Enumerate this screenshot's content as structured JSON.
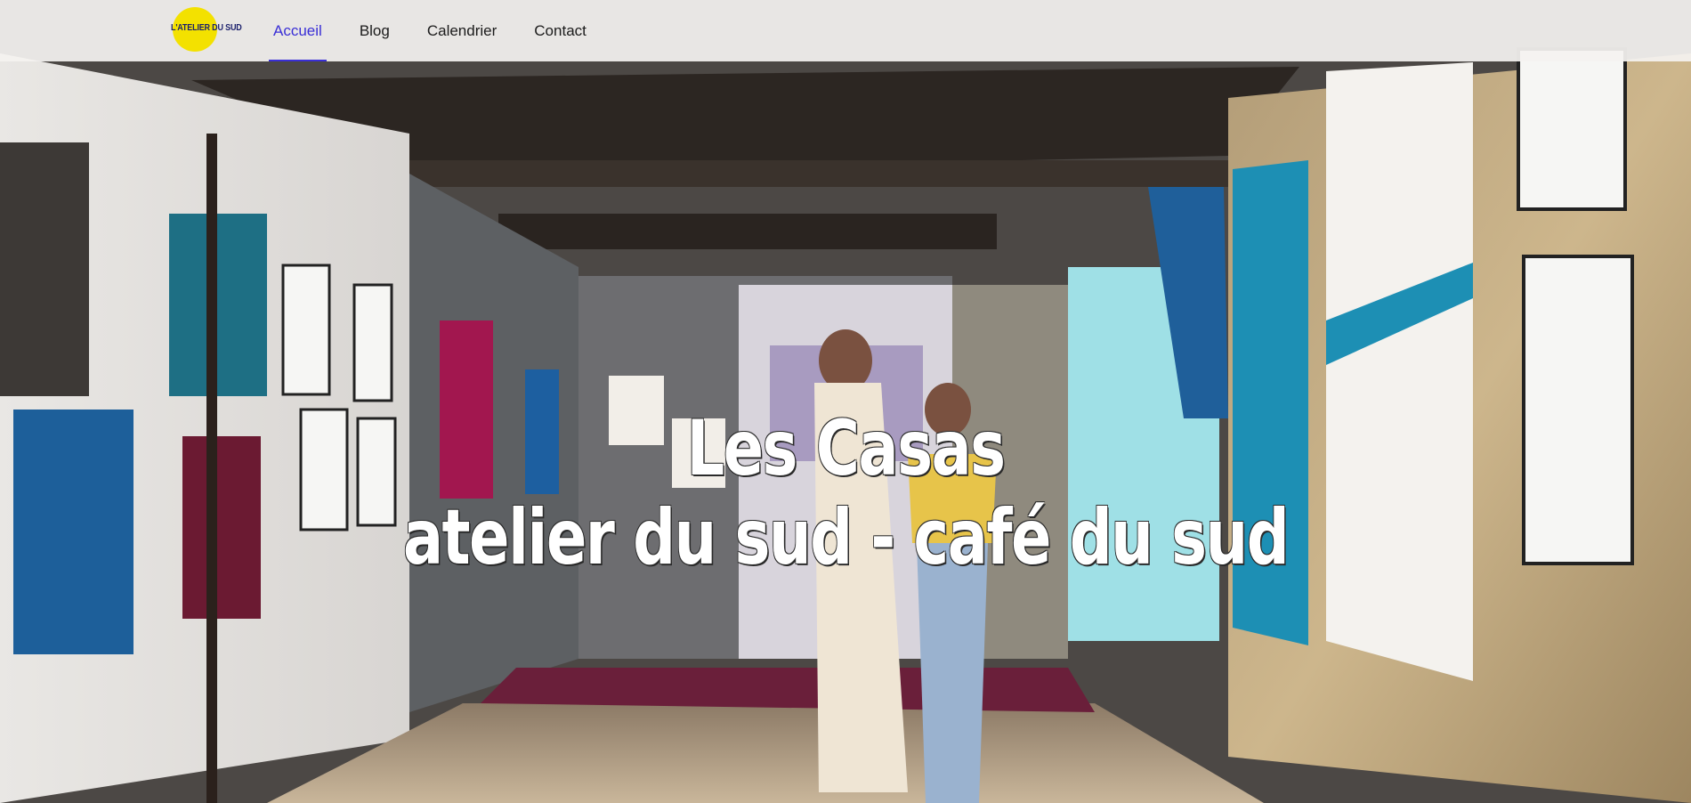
{
  "header": {
    "logo_text": "L'ATELIER DU SUD",
    "nav": [
      {
        "label": "Accueil",
        "active": true
      },
      {
        "label": "Blog",
        "active": false
      },
      {
        "label": "Calendrier",
        "active": false
      },
      {
        "label": "Contact",
        "active": false
      }
    ]
  },
  "hero": {
    "title_line1": "Les Casas",
    "title_line2": "atelier du sud - café du sud"
  },
  "colors": {
    "accent": "#3a2fd6",
    "logo_sun": "#f3e100",
    "logo_text": "#1a1f6b"
  }
}
